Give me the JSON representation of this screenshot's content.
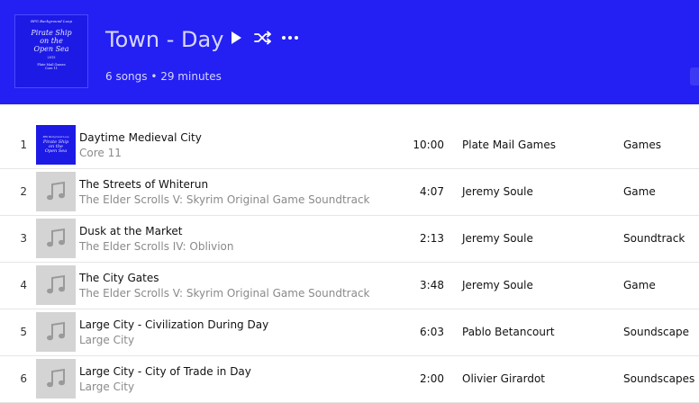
{
  "playlist": {
    "title": "Town - Day",
    "summary": "6 songs • 29 minutes",
    "art": {
      "top_text": "RPG Background Loop",
      "title_lines": [
        "Pirate Ship",
        "on the",
        "Open Sea"
      ],
      "year": "2015",
      "credit_lines": [
        "Plate Mail Games",
        "Core 11"
      ]
    },
    "controls": [
      {
        "name": "play-icon"
      },
      {
        "name": "shuffle-icon"
      },
      {
        "name": "more-options-icon"
      }
    ]
  },
  "tracks": [
    {
      "num": "1",
      "title": "Daytime Medieval City",
      "album": "Core 11",
      "duration": "10:00",
      "artist": "Plate Mail Games",
      "genre": "Games",
      "thumb": "album-art"
    },
    {
      "num": "2",
      "title": "The Streets of Whiterun",
      "album": "The Elder Scrolls V: Skyrim Original Game Soundtrack",
      "duration": "4:07",
      "artist": "Jeremy Soule",
      "genre": "Game",
      "thumb": "music-note-icon"
    },
    {
      "num": "3",
      "title": "Dusk at the Market",
      "album": "The Elder Scrolls IV: Oblivion",
      "duration": "2:13",
      "artist": "Jeremy Soule",
      "genre": "Soundtrack",
      "thumb": "music-note-icon"
    },
    {
      "num": "4",
      "title": "The City Gates",
      "album": "The Elder Scrolls V: Skyrim Original Game Soundtrack",
      "duration": "3:48",
      "artist": "Jeremy Soule",
      "genre": "Game",
      "thumb": "music-note-icon"
    },
    {
      "num": "5",
      "title": "Large City - Civilization During Day",
      "album": "Large City",
      "duration": "6:03",
      "artist": "Pablo Betancourt",
      "genre": "Soundscape",
      "thumb": "music-note-icon"
    },
    {
      "num": "6",
      "title": "Large City - City of Trade in Day",
      "album": "Large City",
      "duration": "2:00",
      "artist": "Olivier Girardot",
      "genre": "Soundscapes",
      "thumb": "music-note-icon"
    }
  ],
  "colors": {
    "header_bg": "#2420f3",
    "title_text": "#d6d6ff",
    "secondary_text": "#8a8a8a"
  }
}
